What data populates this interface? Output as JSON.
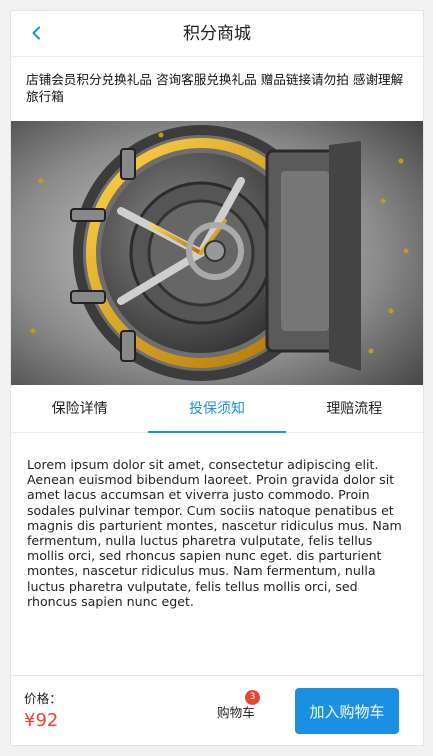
{
  "header": {
    "title": "积分商城",
    "back_icon": "chevron-left-icon"
  },
  "description": "店铺会员积分兑换礼品 咨询客服兑换礼品 赠品链接请勿拍 感谢理解 旅行箱",
  "banner": {
    "image": "bank-vault-door"
  },
  "tabs": [
    {
      "label": "保险详情",
      "active": false
    },
    {
      "label": "投保须知",
      "active": true
    },
    {
      "label": "理赔流程",
      "active": false
    }
  ],
  "content": "Lorem ipsum dolor sit amet, consectetur adipiscing elit. Aenean euismod bibendum laoreet. Proin gravida dolor sit amet lacus accumsan et viverra justo commodo. Proin sodales pulvinar tempor. Cum sociis natoque penatibus et magnis dis parturient montes, nascetur ridiculus mus. Nam fermentum, nulla luctus pharetra vulputate, felis tellus mollis orci, sed rhoncus sapien nunc eget. dis parturient montes, nascetur ridiculus mus. Nam fermentum, nulla luctus pharetra vulputate, felis tellus mollis orci, sed rhoncus sapien nunc eget.",
  "footer": {
    "price_label": "价格：",
    "price": "¥92",
    "cart_label": "购物车",
    "cart_count": "3",
    "add_button": "加入购物车"
  },
  "colors": {
    "accent": "#1a8fe3",
    "price": "#e84536",
    "badge": "#e84536"
  }
}
